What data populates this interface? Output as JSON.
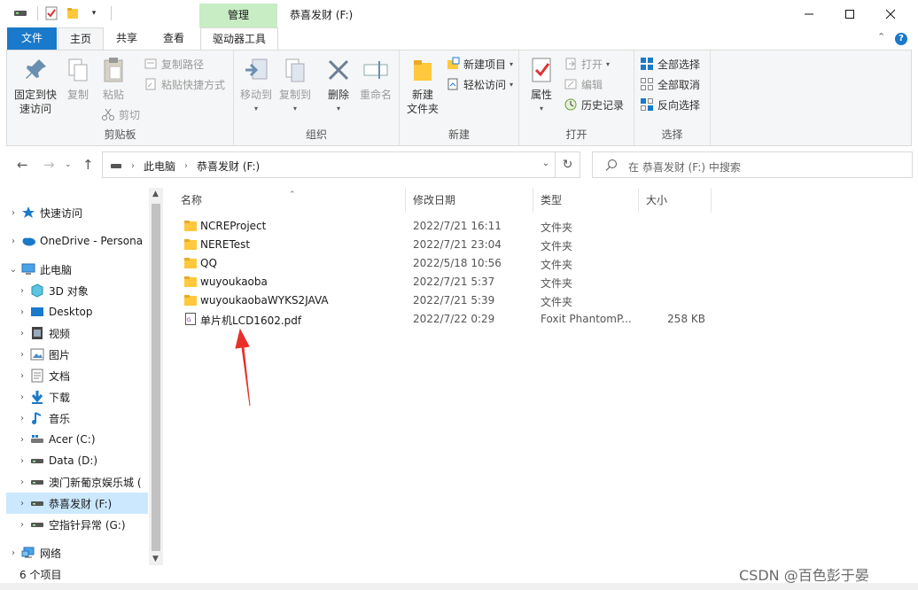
{
  "window": {
    "title": "恭喜发财 (F:)",
    "context_tab": "管理",
    "controls": {
      "minimize": "—",
      "maximize": "☐",
      "close": "✕"
    }
  },
  "ribbon_tabs": {
    "file": "文件",
    "home": "主页",
    "share": "共享",
    "view": "查看",
    "drive_tools": "驱动器工具"
  },
  "ribbon": {
    "clipboard": {
      "group": "剪贴板",
      "pin_line1": "固定到快",
      "pin_line2": "速访问",
      "copy": "复制",
      "paste": "粘贴",
      "copy_path": "复制路径",
      "paste_shortcut": "粘贴快捷方式",
      "cut": "剪切"
    },
    "organize": {
      "group": "组织",
      "move_to": "移动到",
      "copy_to": "复制到",
      "delete": "删除",
      "rename": "重命名"
    },
    "new": {
      "group": "新建",
      "new_folder_line1": "新建",
      "new_folder_line2": "文件夹",
      "new_item": "新建项目",
      "easy_access": "轻松访问"
    },
    "open": {
      "group": "打开",
      "properties": "属性",
      "open": "打开",
      "edit": "编辑",
      "history": "历史记录"
    },
    "select": {
      "group": "选择",
      "select_all": "全部选择",
      "select_none": "全部取消",
      "invert": "反向选择"
    }
  },
  "address": {
    "crumbs": [
      "此电脑",
      "恭喜发财 (F:)"
    ],
    "search_placeholder": "在 恭喜发财 (F:) 中搜索"
  },
  "nav_pane": [
    {
      "label": "快速访问",
      "icon": "star-icon",
      "indent": 0,
      "expander": "›"
    },
    {
      "label": "OneDrive - Persona",
      "icon": "cloud-icon",
      "indent": 0,
      "expander": "›"
    },
    {
      "label": "此电脑",
      "icon": "computer-icon",
      "indent": 0,
      "expander": "⌄"
    },
    {
      "label": "3D 对象",
      "icon": "cube-icon",
      "indent": 1,
      "expander": "›"
    },
    {
      "label": "Desktop",
      "icon": "desktop-icon",
      "indent": 1,
      "expander": "›"
    },
    {
      "label": "视频",
      "icon": "video-icon",
      "indent": 1,
      "expander": "›"
    },
    {
      "label": "图片",
      "icon": "picture-icon",
      "indent": 1,
      "expander": "›"
    },
    {
      "label": "文档",
      "icon": "document-icon",
      "indent": 1,
      "expander": "›"
    },
    {
      "label": "下载",
      "icon": "download-icon",
      "indent": 1,
      "expander": "›"
    },
    {
      "label": "音乐",
      "icon": "music-icon",
      "indent": 1,
      "expander": "›"
    },
    {
      "label": "Acer (C:)",
      "icon": "system-drive-icon",
      "indent": 1,
      "expander": "›"
    },
    {
      "label": "Data (D:)",
      "icon": "drive-icon",
      "indent": 1,
      "expander": "›"
    },
    {
      "label": "澳门新葡京娱乐城 (",
      "icon": "drive-icon",
      "indent": 1,
      "expander": "›"
    },
    {
      "label": "恭喜发财 (F:)",
      "icon": "drive-icon",
      "indent": 1,
      "expander": "›",
      "selected": true
    },
    {
      "label": "空指针异常 (G:)",
      "icon": "drive-icon",
      "indent": 1,
      "expander": "›"
    },
    {
      "label": "网络",
      "icon": "network-icon",
      "indent": 0,
      "expander": "›"
    }
  ],
  "columns": {
    "name": "名称",
    "modified": "修改日期",
    "type": "类型",
    "size": "大小"
  },
  "files": [
    {
      "name": "NCREProject",
      "modified": "2022/7/21 16:11",
      "type": "文件夹",
      "size": "",
      "icon": "folder-icon"
    },
    {
      "name": "NERETest",
      "modified": "2022/7/21 23:04",
      "type": "文件夹",
      "size": "",
      "icon": "folder-icon"
    },
    {
      "name": "QQ",
      "modified": "2022/5/18 10:56",
      "type": "文件夹",
      "size": "",
      "icon": "folder-icon"
    },
    {
      "name": "wuyoukaoba",
      "modified": "2022/7/21 5:37",
      "type": "文件夹",
      "size": "",
      "icon": "folder-icon"
    },
    {
      "name": "wuyoukaobaWYKS2JAVA",
      "modified": "2022/7/21 5:39",
      "type": "文件夹",
      "size": "",
      "icon": "folder-icon"
    },
    {
      "name": "单片机LCD1602.pdf",
      "modified": "2022/7/22 0:29",
      "type": "Foxit PhantomP...",
      "size": "258 KB",
      "icon": "pdf-icon"
    }
  ],
  "status": {
    "item_count": "6 个项目"
  },
  "watermark": "CSDN @百色彭于晏",
  "colors": {
    "accent": "#1979ca",
    "selection": "#cce8ff",
    "context_tab": "#c8ecc4",
    "annotation_arrow": "#e8302b",
    "folder": "#ffc83d"
  }
}
